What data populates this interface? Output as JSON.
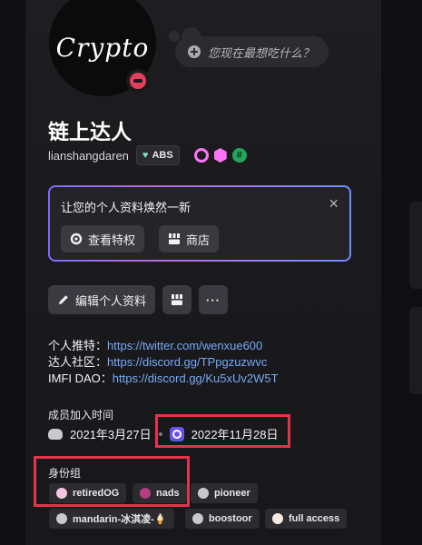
{
  "profile": {
    "avatar_text": "Crypto",
    "status_bubble": "您现在最想吃什么？",
    "display_name": "链上达人",
    "username": "lianshangdaren",
    "tag": "ABS"
  },
  "promo": {
    "title": "让您的个人资料焕然一新",
    "close": "×",
    "perks_label": "查看特权",
    "shop_label": "商店"
  },
  "actions": {
    "edit_label": "编辑个人资料",
    "more_label": "···"
  },
  "links": [
    {
      "label": "个人推特：",
      "url": "https://twitter.com/wenxue600"
    },
    {
      "label": "达人社区：",
      "url": "https://discord.gg/TPpgzuzwvc"
    },
    {
      "label": "IMFI DAO：",
      "url": "https://discord.gg/Ku5xUv2W5T"
    }
  ],
  "member_since": {
    "title": "成员加入时间",
    "discord_date": "2021年3月27日",
    "server_date": "2022年11月28日"
  },
  "roles": {
    "title": "身份组",
    "items": [
      {
        "name": "retiredOG",
        "color": "#f7c6e1"
      },
      {
        "name": "nads",
        "color": "#b83c82"
      },
      {
        "name": "pioneer",
        "color": "#c7c9ce"
      },
      {
        "name": "mandarin-冰淇凌-🍦",
        "color": "#c7c9ce"
      },
      {
        "name": "boostoor",
        "color": "#c7c9ce"
      },
      {
        "name": "full access",
        "color": "#fbe9e3"
      }
    ]
  }
}
